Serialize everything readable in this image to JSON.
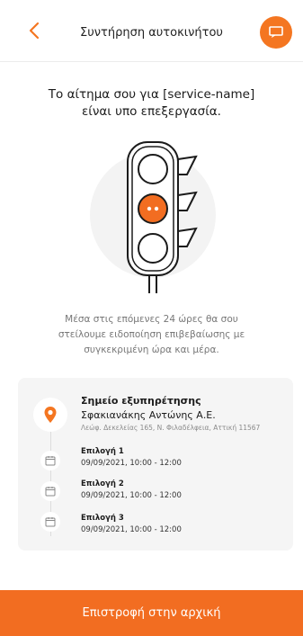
{
  "header": {
    "title": "Συντήρηση αυτοκινήτου",
    "back_icon": "chevron-left-icon",
    "chat_icon": "chat-icon"
  },
  "colors": {
    "accent": "#f47621"
  },
  "main": {
    "heading_line1": "Το αίτημα σου για [service-name]",
    "heading_line2": "είναι υπο επεξεργασία.",
    "info_line1": "Μέσα στις επόμενες 24 ώρες θα σου",
    "info_line2": "στείλουμε ειδοποίηση επιβεβαίωσης με",
    "info_line3": "συγκεκριμένη ώρα και μέρα."
  },
  "service_point": {
    "title": "Σημείο εξυπηρέτησης",
    "name": "Σφακιανάκης Αντώνης Α.Ε.",
    "address": "Λεώφ. Δεκελείας 165, Ν. Φιλαδέλφεια, Αττική 11567"
  },
  "options": [
    {
      "label": "Επιλογή 1",
      "datetime": "09/09/2021, 10:00 - 12:00"
    },
    {
      "label": "Επιλογή 2",
      "datetime": "09/09/2021, 10:00 - 12:00"
    },
    {
      "label": "Επιλογή 3",
      "datetime": "09/09/2021, 10:00 - 12:00"
    }
  ],
  "footer": {
    "button_label": "Επιστροφή στην αρχική"
  }
}
